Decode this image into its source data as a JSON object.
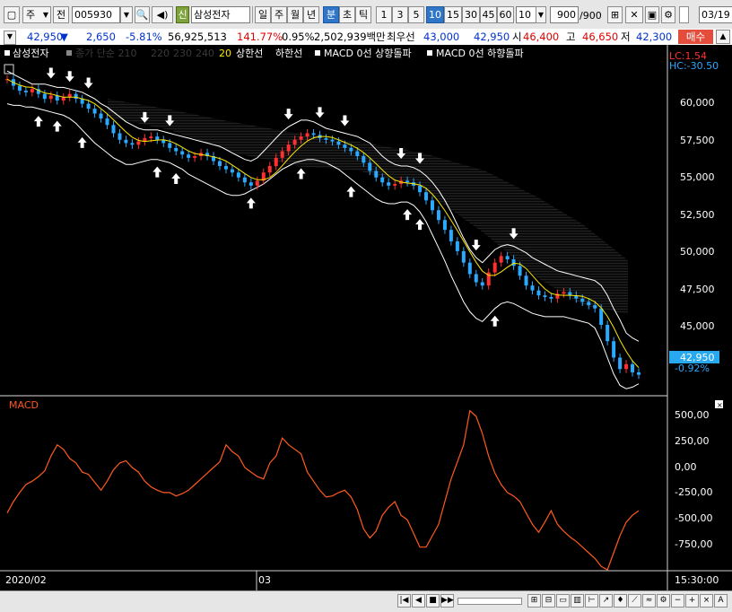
{
  "toolbar": {
    "market_select": "주",
    "market_btn": "전",
    "code": "005930",
    "name_badge": "신",
    "name": "삼성전자",
    "periods": [
      "일",
      "주",
      "월",
      "년",
      "분",
      "초",
      "틱"
    ],
    "active_period": "분",
    "intervals": [
      "1",
      "3",
      "5",
      "10",
      "15",
      "30",
      "45",
      "60"
    ],
    "active_interval": "10",
    "interval_value": "10",
    "count": "900",
    "count_max": "/900",
    "date": "03/19"
  },
  "quote": {
    "price": "42,950",
    "arrow": "▼",
    "change": "2,650",
    "change_pct": "-5.81%",
    "volume": "56,925,513",
    "vol_ratio": "141.77%",
    "turnover": "0.95%",
    "amount": "2,502,939백만",
    "best_ask_label": "최우선",
    "best_ask": "43,000",
    "best_bid": "42,950",
    "open_label": "시",
    "open": "46,400",
    "high_label": "고",
    "high": "46,650",
    "low_label": "저",
    "low": "42,300",
    "buy_button": "매수"
  },
  "legend": {
    "stock": "삼성전자",
    "ma": "종가 단순 210",
    "ma_periods": [
      "220",
      "230",
      "240"
    ],
    "ma_last": "20",
    "items": [
      "상한선",
      "하한선",
      "MACD 0선 상향돌파",
      "MACD 0선 하향돌파"
    ]
  },
  "price_axis": {
    "ticks": [
      "60,000",
      "57,500",
      "55,000",
      "52,500",
      "50,000",
      "47,500",
      "45,000"
    ],
    "lc": "LC:1.54",
    "hc": "HC:-30.50",
    "last_price": "42,950",
    "last_pct": "-0.92%"
  },
  "macd": {
    "title": "MACD",
    "ticks": [
      "500,00",
      "250,00",
      "0,00",
      "-250,00",
      "-500,00",
      "-750,00"
    ]
  },
  "time_axis": {
    "left": "2020/02",
    "mid": "03",
    "right": "15:30:00"
  },
  "colors": {
    "up": "#ff3030",
    "down": "#2aa9ff",
    "macd": "#ff5a1f",
    "band": "#ffffff",
    "ma20": "#ffe800",
    "axis_text": "#ffffff",
    "quote_down": "#0033cc",
    "quote_up": "#e00000"
  },
  "chart_data": {
    "type": "candlestick",
    "price_range": [
      42000,
      62000
    ],
    "macd_range": [
      -900,
      600
    ],
    "close": [
      61000,
      60600,
      60300,
      60200,
      60400,
      60100,
      59800,
      60000,
      59700,
      59900,
      60100,
      59800,
      59500,
      59200,
      58900,
      58600,
      58200,
      57700,
      57300,
      57100,
      57000,
      57200,
      57400,
      57500,
      57300,
      57100,
      56800,
      56600,
      56400,
      56200,
      56300,
      56500,
      56300,
      56000,
      55700,
      55500,
      55300,
      55000,
      54700,
      54500,
      54800,
      55300,
      55700,
      56200,
      56600,
      57000,
      57300,
      57500,
      57700,
      57600,
      57400,
      57300,
      57200,
      57000,
      56800,
      56600,
      56300,
      55900,
      55400,
      55000,
      54700,
      54500,
      54600,
      54800,
      54700,
      54500,
      54100,
      53600,
      53000,
      52400,
      51800,
      51100,
      50500,
      49800,
      49100,
      48600,
      48400,
      49200,
      49800,
      50200,
      50000,
      49600,
      49000,
      48400,
      48100,
      47800,
      47700,
      47600,
      47900,
      48000,
      47800,
      47600,
      47400,
      47200,
      47000,
      46000,
      45000,
      44000,
      43300,
      43600,
      43100,
      42950
    ],
    "upper": [
      61500,
      61300,
      61100,
      60900,
      60700,
      60700,
      60700,
      60600,
      60500,
      60500,
      60400,
      60300,
      60200,
      60000,
      59800,
      59500,
      59300,
      59000,
      58700,
      58400,
      58200,
      58000,
      57900,
      57900,
      57900,
      57800,
      57700,
      57600,
      57500,
      57400,
      57300,
      57200,
      57100,
      57000,
      56900,
      56700,
      56500,
      56300,
      56100,
      56000,
      56200,
      56600,
      57000,
      57400,
      57800,
      58100,
      58300,
      58500,
      58500,
      58400,
      58200,
      58000,
      57900,
      57800,
      57700,
      57600,
      57500,
      57300,
      57100,
      56700,
      56300,
      56000,
      55800,
      55700,
      55700,
      55600,
      55400,
      55100,
      54700,
      54200,
      53600,
      52900,
      52100,
      51300,
      50600,
      50100,
      49800,
      50200,
      50600,
      50800,
      50900,
      50800,
      50600,
      50400,
      50100,
      49900,
      49700,
      49500,
      49300,
      49200,
      49100,
      49000,
      48900,
      48800,
      48700,
      48400,
      47800,
      47000,
      46300,
      45500,
      45200,
      45000
    ],
    "lower": [
      59500,
      59400,
      59400,
      59300,
      59300,
      59200,
      59100,
      59000,
      58900,
      58800,
      58600,
      58300,
      57900,
      57500,
      57100,
      56800,
      56500,
      56200,
      56000,
      55800,
      55800,
      55900,
      56000,
      56100,
      56100,
      56000,
      55900,
      55700,
      55500,
      55200,
      55000,
      54800,
      54600,
      54400,
      54200,
      54000,
      53900,
      53900,
      54000,
      54200,
      54400,
      54600,
      54900,
      55200,
      55500,
      55700,
      55900,
      56000,
      56100,
      56100,
      56000,
      55900,
      55700,
      55500,
      55200,
      54900,
      54600,
      54300,
      54000,
      53700,
      53500,
      53400,
      53400,
      53500,
      53500,
      53300,
      52900,
      52300,
      51500,
      50700,
      49900,
      49000,
      48200,
      47400,
      46800,
      46400,
      46200,
      46600,
      47000,
      47300,
      47400,
      47300,
      47100,
      46900,
      46700,
      46600,
      46500,
      46500,
      46500,
      46500,
      46400,
      46300,
      46200,
      46100,
      45800,
      45000,
      44000,
      43000,
      42300,
      42100,
      42200,
      42400
    ],
    "macd": [
      -400,
      -300,
      -220,
      -150,
      -120,
      -80,
      -30,
      100,
      200,
      160,
      80,
      40,
      -40,
      -60,
      -130,
      -200,
      -120,
      -20,
      40,
      60,
      0,
      -40,
      -120,
      -170,
      -200,
      -220,
      -220,
      -250,
      -230,
      -200,
      -150,
      -100,
      -50,
      0,
      50,
      200,
      140,
      100,
      0,
      -40,
      -80,
      -100,
      40,
      100,
      260,
      200,
      160,
      120,
      -40,
      -120,
      -200,
      -260,
      -250,
      -220,
      -200,
      -260,
      -370,
      -540,
      -620,
      -560,
      -420,
      -350,
      -300,
      -420,
      -460,
      -580,
      -700,
      -700,
      -600,
      -500,
      -300,
      -100,
      50,
      200,
      500,
      450,
      300,
      100,
      -50,
      -150,
      -220,
      -250,
      -300,
      -400,
      -500,
      -570,
      -480,
      -380,
      -500,
      -560,
      -610,
      -650,
      -700,
      -750,
      -800,
      -870,
      -900,
      -750,
      -600,
      -480,
      -420,
      -380
    ],
    "up_arrows_idx": [
      5,
      8,
      12,
      24,
      27,
      39,
      47,
      55,
      64,
      66,
      78
    ],
    "down_arrows_idx": [
      7,
      10,
      13,
      22,
      26,
      45,
      50,
      54,
      63,
      66,
      75,
      81
    ]
  }
}
